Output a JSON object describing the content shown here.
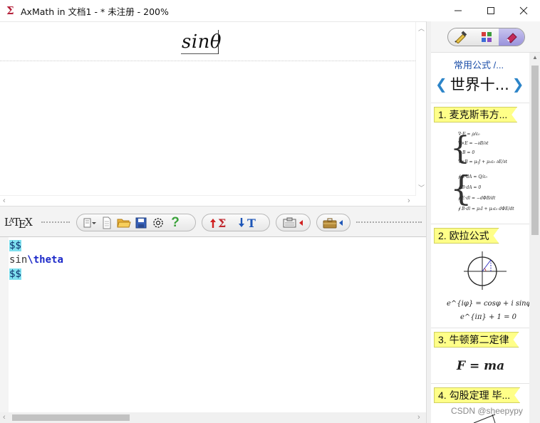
{
  "window": {
    "title": "AxMath in 文档1 - * 未注册 - 200%",
    "minimize_label": "—",
    "maximize_label": "☐",
    "close_label": "✕"
  },
  "preview": {
    "formula": "sinθ"
  },
  "toolbar": {
    "latex_logo": "LATEX",
    "groups": [
      "file-tools",
      "sum-tools",
      "text-tools",
      "clipboard-tools",
      "briefcase-tools"
    ]
  },
  "editor": {
    "lines": [
      {
        "parts": [
          {
            "text": "$$",
            "style": "hl"
          }
        ]
      },
      {
        "parts": [
          {
            "text": "sin",
            "style": "plain"
          },
          {
            "text": "\\theta",
            "style": "kw"
          }
        ]
      },
      {
        "parts": [
          {
            "text": "$$",
            "style": "hl"
          }
        ]
      }
    ]
  },
  "panel": {
    "category_link": "常用公式 /...",
    "nav_title": "世界十...",
    "nav_prev": "❮",
    "nav_next": "❯",
    "entries": [
      {
        "label": "1. 麦克斯韦方...",
        "formulas": [
          "∇·E = ρ/ε₀",
          "∇×E = −∂B/∂t",
          "∇·B = 0",
          "∇×B = μ₀J + μ₀ε₀ ∂E/∂t",
          "∮ E·dA = Q/ε₀",
          "∮ B·dA = 0",
          "∮ E·dl = −dΦB/dt",
          "∮ B·dl = μ₀I + μ₀ε₀ dΦE/dt"
        ]
      },
      {
        "label": "2. 欧拉公式",
        "formulas": [
          "e^{iφ} = cosφ + i sinφ",
          "e^{iπ} + 1 = 0"
        ]
      },
      {
        "label": "3. 牛顿第二定律",
        "formulas": [
          "F = ma"
        ]
      },
      {
        "label": "4. 勾股定理 毕...",
        "formulas": []
      }
    ]
  },
  "watermark": "CSDN @sheepypy"
}
